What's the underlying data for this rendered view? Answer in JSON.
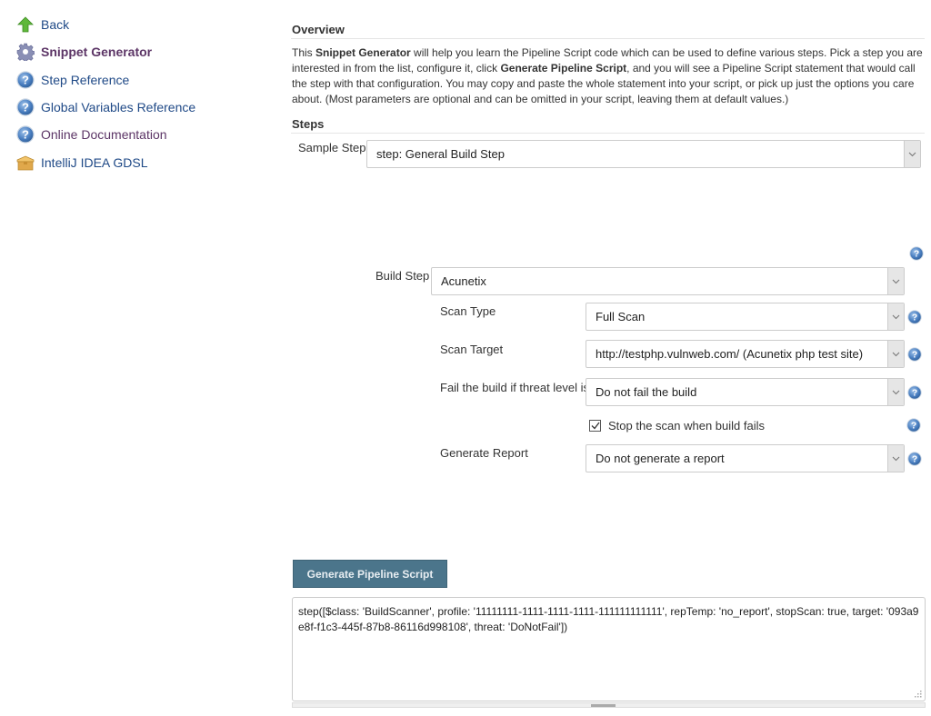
{
  "sidebar": {
    "items": [
      {
        "label": "Back",
        "icon": "up-arrow-icon"
      },
      {
        "label": "Snippet Generator",
        "icon": "gear-icon"
      },
      {
        "label": "Step Reference",
        "icon": "help-icon"
      },
      {
        "label": "Global Variables Reference",
        "icon": "help-icon"
      },
      {
        "label": "Online Documentation",
        "icon": "help-icon"
      },
      {
        "label": "IntelliJ IDEA GDSL",
        "icon": "package-icon"
      }
    ]
  },
  "overview": {
    "title": "Overview",
    "text_1": "This ",
    "bold_1": "Snippet Generator",
    "text_2": " will help you learn the Pipeline Script code which can be used to define various steps. Pick a step you are interested in from the list, configure it, click ",
    "bold_2": "Generate Pipeline Script",
    "text_3": ", and you will see a Pipeline Script statement that would call the step with that configuration. You may copy and paste the whole statement into your script, or pick up just the options you care about. (Most parameters are optional and can be omitted in your script, leaving them at default values.)"
  },
  "steps": {
    "title": "Steps",
    "sample_step_label": "Sample Step",
    "sample_step_value": "step: General Build Step",
    "build_step_label": "Build Step",
    "build_step_value": "Acunetix",
    "scan_type_label": "Scan Type",
    "scan_type_value": "Full Scan",
    "scan_target_label": "Scan Target",
    "scan_target_value": "http://testphp.vulnweb.com/ (Acunetix php test site)",
    "threat_label": "Fail the build if threat level is",
    "threat_value": "Do not fail the build",
    "stop_scan_label": "Stop the scan when build fails",
    "stop_scan_checked": true,
    "report_label": "Generate Report",
    "report_value": "Do not generate a report"
  },
  "generate_button": "Generate Pipeline Script",
  "output_script": "step([$class: 'BuildScanner', profile: '11111111-1111-1111-1111-111111111111', repTemp: 'no_report', stopScan: true, target: '093a9e8f-f1c3-445f-87b8-86116d998108', threat: 'DoNotFail'])",
  "colors": {
    "link": "#204a87",
    "visited": "#5c3566",
    "button_bg": "#4b758b",
    "help_icon": "#3465a4"
  }
}
